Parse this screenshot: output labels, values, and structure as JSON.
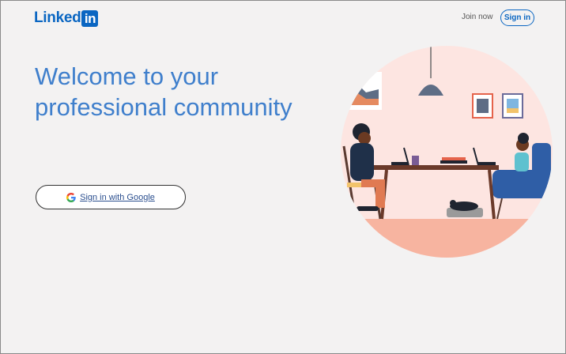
{
  "header": {
    "logo": {
      "word": "Linked",
      "box": "in"
    },
    "join_now_label": "Join now",
    "sign_in_label": "Sign in"
  },
  "hero": {
    "title": "Welcome to your professional community",
    "google_button_label": "Sign in with Google"
  },
  "icons": {
    "google": "google-g-icon",
    "illustration": "people-working-at-table-illustration"
  },
  "colors": {
    "brand": "#0a66c2",
    "title": "#3f7fcc",
    "background": "#f3f2f2",
    "illustration_bg": "#fde5e1",
    "floor": "#f7b4a0"
  }
}
